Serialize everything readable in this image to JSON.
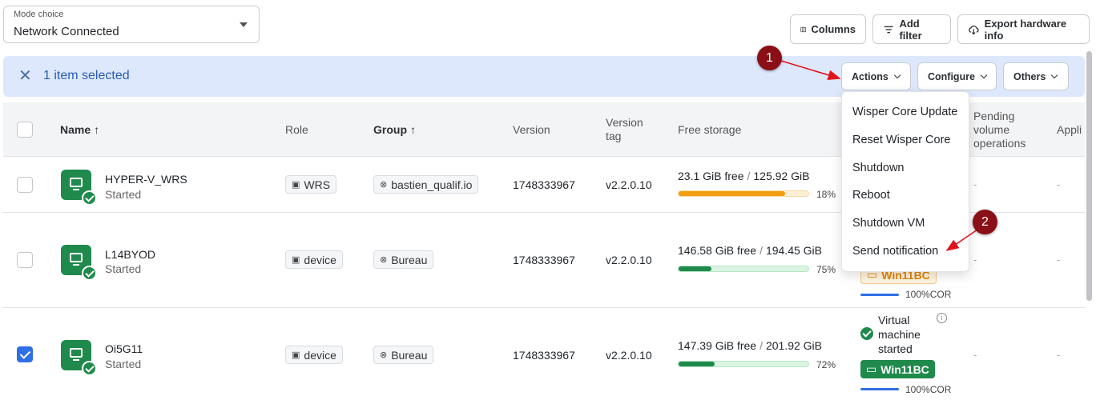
{
  "mode": {
    "label": "Mode choice",
    "value": "Network Connected"
  },
  "toolbar": {
    "columns_label": "Columns",
    "add_filter_label": "Add filter",
    "export_label": "Export hardware info"
  },
  "selection": {
    "text": "1 item selected",
    "actions_label": "Actions",
    "configure_label": "Configure",
    "others_label": "Others"
  },
  "table": {
    "headers": {
      "name": "Name",
      "role": "Role",
      "group": "Group",
      "version": "Version",
      "version_tag": "Version tag",
      "free_storage": "Free storage",
      "pending": "Pending volume operations",
      "appli": "Appli"
    },
    "rows": [
      {
        "name": "HYPER-V_WRS",
        "status": "Started",
        "role": "WRS",
        "group": "bastien_qualif.io",
        "version": "1748333967",
        "tag": "v2.2.0.10",
        "free": "23.1 GiB free",
        "total": "125.92 GiB",
        "pct_label": "18%",
        "pending": "-",
        "appli": "-",
        "selected": false
      },
      {
        "name": "L14BYOD",
        "status": "Started",
        "role": "device",
        "group": "Bureau",
        "version": "1748333967",
        "tag": "v2.2.0.10",
        "free": "146.58 GiB free",
        "total": "194.45 GiB",
        "pct_label": "75%",
        "vm_name": "Win11BC",
        "vm_pct": "100%COR",
        "pending": "-",
        "appli": "-",
        "selected": false
      },
      {
        "name": "Oi5G11",
        "status": "Started",
        "role": "device",
        "group": "Bureau",
        "version": "1748333967",
        "tag": "v2.2.0.10",
        "free": "147.39 GiB free",
        "total": "201.92 GiB",
        "pct_label": "72%",
        "vm_status": "Virtual machine started",
        "vm_name": "Win11BC",
        "vm_pct": "100%COR",
        "pending": "-",
        "appli": "-",
        "selected": true
      }
    ]
  },
  "dropdown": {
    "items": [
      "Wisper Core Update",
      "Reset Wisper Core",
      "Shutdown",
      "Reboot",
      "Shutdown VM",
      "Send notification"
    ]
  },
  "annotations": {
    "one": "1",
    "two": "2"
  },
  "colors": {
    "accent": "#2f6fe4",
    "green": "#1f8a4c",
    "warning": "#f29d0e",
    "callout": "#8b0f16"
  }
}
